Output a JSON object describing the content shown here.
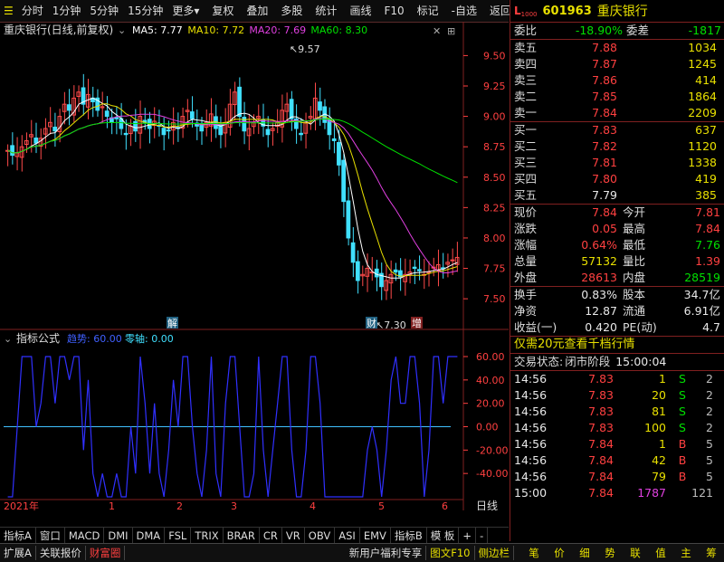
{
  "toolbar": {
    "left": [
      "分时",
      "1分钟",
      "5分钟",
      "15分钟",
      "更多"
    ],
    "right": [
      "复权",
      "叠加",
      "多股",
      "统计",
      "画线",
      "F10",
      "标记",
      "-自选",
      "返回"
    ]
  },
  "main_chart": {
    "title": "重庆银行(日线,前复权)",
    "ma": [
      {
        "label": "MA5: 7.77",
        "color": "#ffffff"
      },
      {
        "label": "MA10: 7.72",
        "color": "#e8e000"
      },
      {
        "label": "MA20: 7.69",
        "color": "#e040e0"
      },
      {
        "label": "MA60: 8.30",
        "color": "#00e000"
      }
    ],
    "price_ticks": [
      "9.50",
      "9.25",
      "9.00",
      "8.75",
      "8.50",
      "8.25",
      "8.00",
      "7.75",
      "7.50"
    ],
    "high_mark": "9.57",
    "low_mark": "7.30",
    "event_marks": [
      "解",
      "财",
      "增"
    ]
  },
  "indicator": {
    "title": "指标公式",
    "trend_label": "趋势: 60.00",
    "zero_label": "零轴: 0.00",
    "ticks": [
      "60.00",
      "40.00",
      "20.00",
      "0.00",
      "-20.00",
      "-40.00"
    ]
  },
  "time_axis": {
    "labels": [
      "2021年",
      "1",
      "2",
      "3",
      "4",
      "5",
      "6"
    ],
    "period": "日线"
  },
  "indicator_tabs": [
    "指标A",
    "窗口",
    "MACD",
    "DMI",
    "DMA",
    "FSL",
    "TRIX",
    "BRAR",
    "CR",
    "VR",
    "OBV",
    "ASI",
    "EMV",
    "指标B",
    "模 板",
    "+",
    "-"
  ],
  "status_bar": {
    "left": [
      "扩展A",
      "关联报价",
      "财富圈"
    ],
    "mid": [
      "新用户福利专享",
      "图文F10",
      "侧边栏"
    ],
    "right": [
      "笔",
      "价",
      "细",
      "势",
      "联",
      "值",
      "主",
      "筹"
    ]
  },
  "quote": {
    "code": "601963",
    "name": "重庆银行",
    "weibi_label": "委比",
    "weibi": "-18.90%",
    "weicha_label": "委差",
    "weicha": "-1817",
    "asks": [
      {
        "label": "卖五",
        "price": "7.88",
        "vol": "1034"
      },
      {
        "label": "卖四",
        "price": "7.87",
        "vol": "1245"
      },
      {
        "label": "卖三",
        "price": "7.86",
        "vol": "414"
      },
      {
        "label": "卖二",
        "price": "7.85",
        "vol": "1864"
      },
      {
        "label": "卖一",
        "price": "7.84",
        "vol": "2209"
      }
    ],
    "bids": [
      {
        "label": "买一",
        "price": "7.83",
        "vol": "637"
      },
      {
        "label": "买二",
        "price": "7.82",
        "vol": "1120"
      },
      {
        "label": "买三",
        "price": "7.81",
        "vol": "1338"
      },
      {
        "label": "买四",
        "price": "7.80",
        "vol": "419"
      },
      {
        "label": "买五",
        "price": "7.79",
        "vol": "385"
      }
    ],
    "stats": [
      {
        "l1": "现价",
        "v1": "7.84",
        "l2": "今开",
        "v2": "7.81"
      },
      {
        "l1": "涨跌",
        "v1": "0.05",
        "l2": "最高",
        "v2": "7.84"
      },
      {
        "l1": "涨幅",
        "v1": "0.64%",
        "l2": "最低",
        "v2": "7.76"
      },
      {
        "l1": "总量",
        "v1": "57132",
        "l2": "量比",
        "v2": "1.39"
      },
      {
        "l1": "外盘",
        "v1": "28613",
        "l2": "内盘",
        "v2": "28519"
      }
    ],
    "stats2": [
      {
        "l1": "换手",
        "v1": "0.83%",
        "l2": "股本",
        "v2": "34.7亿"
      },
      {
        "l1": "净资",
        "v1": "12.87",
        "l2": "流通",
        "v2": "6.91亿"
      },
      {
        "l1": "收益(一)",
        "v1": "0.420",
        "l2": "PE(动)",
        "v2": "4.7"
      }
    ],
    "promo": "仅需20元查看千档行情",
    "trade_state_label": "交易状态:",
    "trade_state": "闭市阶段",
    "trade_time": "15:00:04",
    "ticks": [
      {
        "t": "14:56",
        "p": "7.83",
        "v": "1",
        "s": "S"
      },
      {
        "t": "14:56",
        "p": "7.83",
        "v": "20",
        "s": "S"
      },
      {
        "t": "14:56",
        "p": "7.83",
        "v": "81",
        "s": "S"
      },
      {
        "t": "14:56",
        "p": "7.83",
        "v": "100",
        "s": "S"
      },
      {
        "t": "14:56",
        "p": "7.84",
        "v": "1",
        "s": "B"
      },
      {
        "t": "14:56",
        "p": "7.84",
        "v": "42",
        "s": "B"
      },
      {
        "t": "14:56",
        "p": "7.84",
        "v": "79",
        "s": "B"
      },
      {
        "t": "15:00",
        "p": "7.84",
        "v": "1787",
        "s": "",
        "n": "121"
      }
    ]
  },
  "chart_data": {
    "type": "candlestick",
    "title": "",
    "xlabel": "",
    "ylabel": "",
    "ylim": [
      7.3,
      9.57
    ],
    "indicator_ylim": [
      -60,
      60
    ],
    "note": "approximate close path of daily K-line; price series",
    "closes": [
      8.72,
      8.68,
      8.7,
      8.75,
      8.8,
      8.85,
      8.78,
      8.82,
      8.9,
      8.95,
      8.88,
      9.0,
      9.1,
      9.05,
      9.15,
      9.2,
      9.1,
      9.18,
      9.12,
      9.05,
      9.08,
      9.0,
      8.95,
      8.98,
      8.9,
      8.85,
      8.92,
      8.88,
      9.0,
      8.95,
      8.9,
      8.96,
      8.92,
      8.85,
      8.88,
      8.95,
      8.9,
      9.0,
      9.05,
      8.98,
      8.92,
      8.88,
      8.95,
      9.02,
      8.9,
      8.85,
      8.95,
      9.1,
      9.2,
      9.0,
      8.88,
      8.9,
      8.95,
      9.0,
      8.92,
      8.85,
      8.9,
      8.95,
      9.05,
      9.1,
      8.98,
      8.9,
      8.85,
      8.95,
      9.0,
      9.15,
      9.05,
      8.95,
      8.85,
      8.8,
      8.6,
      8.3,
      8.0,
      7.8,
      7.65,
      7.7,
      7.75,
      7.72,
      7.68,
      7.6,
      7.65,
      7.7,
      7.72,
      7.68,
      7.7,
      7.72,
      7.75,
      7.73,
      7.7,
      7.72,
      7.76,
      7.78,
      7.75,
      7.8,
      7.82,
      7.84
    ]
  }
}
